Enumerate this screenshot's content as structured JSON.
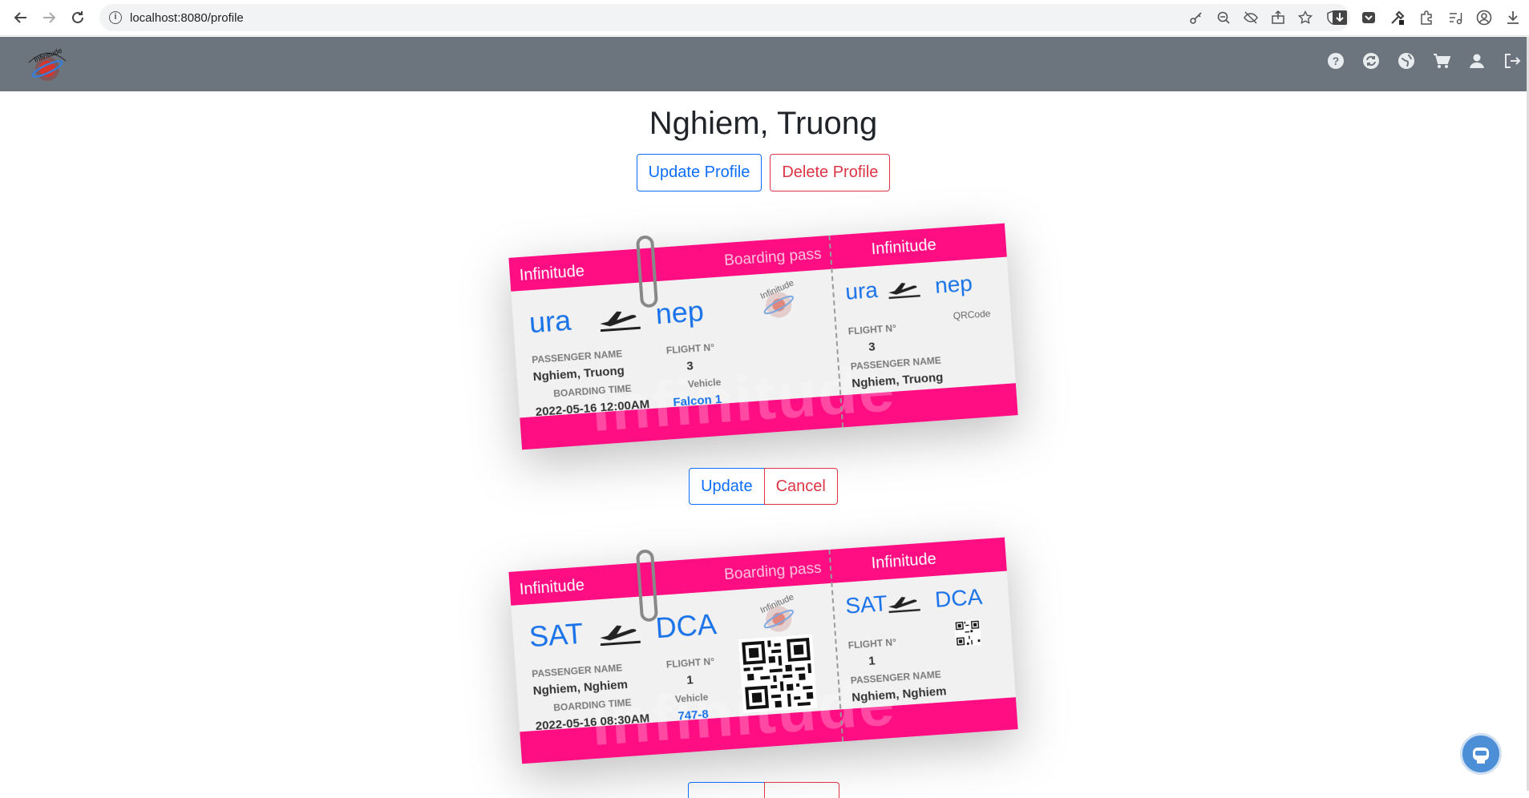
{
  "browser": {
    "url": "localhost:8080/profile",
    "back_icon": "back-arrow-icon",
    "forward_icon": "forward-arrow-icon",
    "reload_icon": "reload-icon"
  },
  "app": {
    "logo_text": "Infinitude",
    "header_icons": [
      "help-icon",
      "sync-icon",
      "globe-icon",
      "cart-icon",
      "user-icon",
      "logout-icon"
    ]
  },
  "profile": {
    "name": "Nghiem, Truong",
    "update_label": "Update Profile",
    "delete_label": "Delete Profile"
  },
  "tickets": [
    {
      "brand": "Infinitude",
      "boarding_pass": "Boarding pass",
      "from": "ura",
      "to": "nep",
      "passenger_label": "PASSENGER NAME",
      "passenger": "Nghiem, Truong",
      "boarding_time_label": "BOARDING TIME",
      "boarding_time": "2022-05-16 12:00AM",
      "flight_label": "FLIGHT N°",
      "flight": "3",
      "vehicle_label": "Vehicle",
      "vehicle": "Falcon 1",
      "qr_alt": "QRCode",
      "update_label": "Update",
      "cancel_label": "Cancel"
    },
    {
      "brand": "Infinitude",
      "boarding_pass": "Boarding pass",
      "from": "SAT",
      "to": "DCA",
      "passenger_label": "PASSENGER NAME",
      "passenger": "Nghiem, Nghiem",
      "boarding_time_label": "BOARDING TIME",
      "boarding_time": "2022-05-16 08:30AM",
      "flight_label": "FLIGHT N°",
      "flight": "1",
      "vehicle_label": "Vehicle",
      "vehicle": "747-8"
    }
  ],
  "colors": {
    "ticket_pink": "#ff0d83",
    "header_gray": "#6c757d",
    "link_blue": "#1a73e8"
  }
}
